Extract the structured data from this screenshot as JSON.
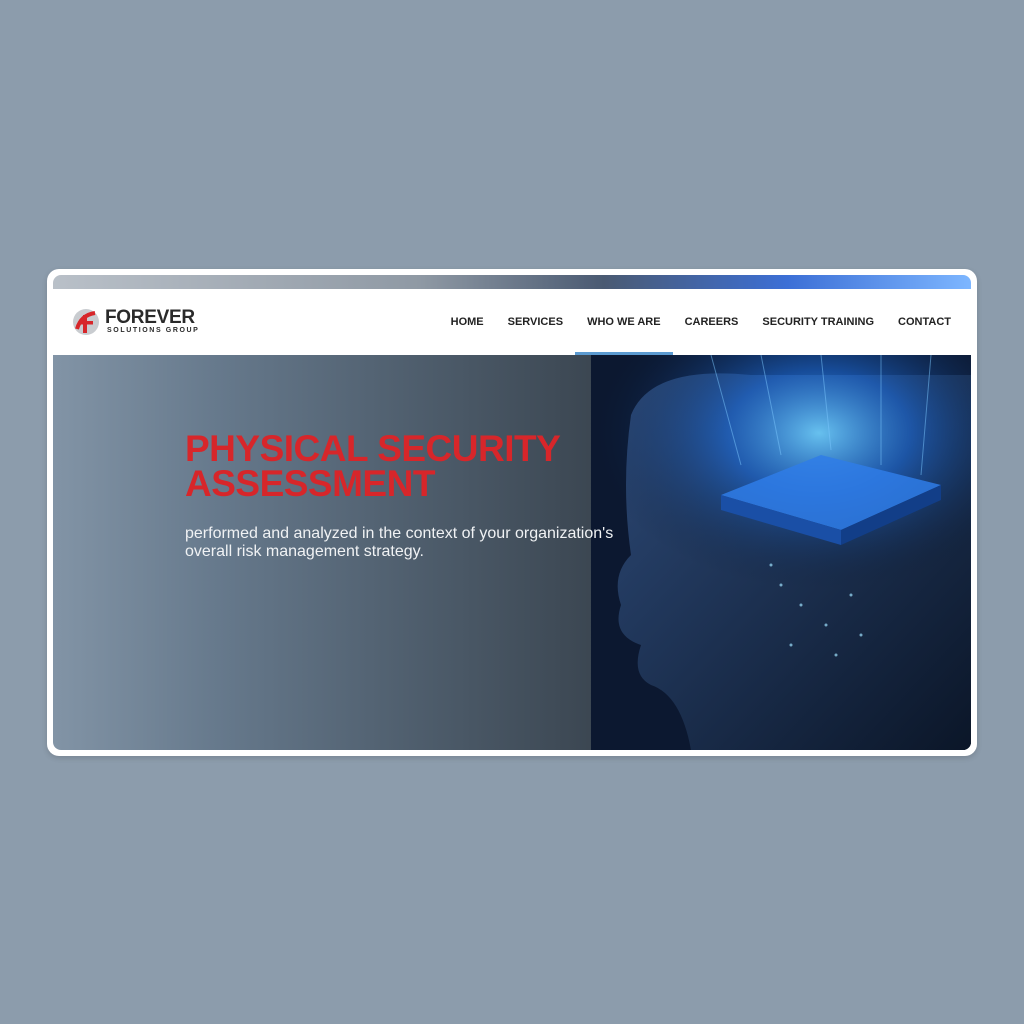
{
  "brand": {
    "name": "FOREVER",
    "tagline": "SOLUTIONS GROUP",
    "accent": "#d7262a"
  },
  "nav": {
    "items": [
      {
        "label": "HOME"
      },
      {
        "label": "SERVICES"
      },
      {
        "label": "WHO WE ARE"
      },
      {
        "label": "CAREERS"
      },
      {
        "label": "SECURITY TRAINING"
      },
      {
        "label": "CONTACT"
      }
    ],
    "active": "WHO WE ARE",
    "active_color": "#5b9ad0"
  },
  "hero": {
    "title": "PHYSICAL SECURITY ASSESSMENT",
    "subtitle": "performed and analyzed in the context of your organization's overall risk management strategy.",
    "image": "digital-head-circuit-illustration"
  }
}
